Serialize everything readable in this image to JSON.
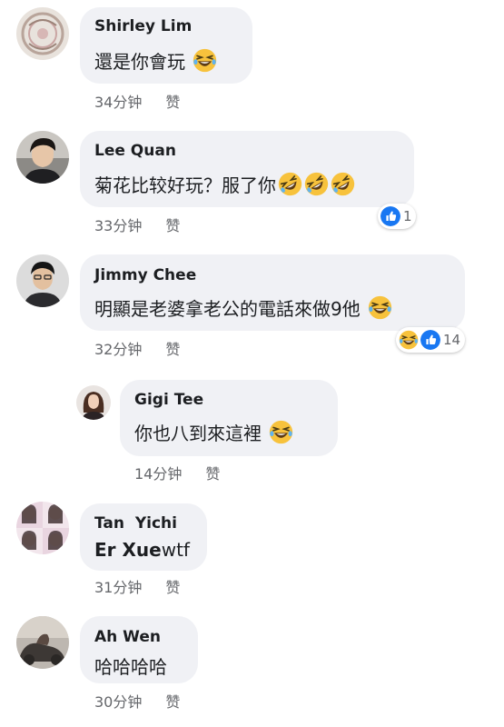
{
  "comments": [
    {
      "name": "Shirley Lim",
      "text": "還是你會玩",
      "time": "34分钟",
      "like": "赞"
    },
    {
      "name": "Lee Quan",
      "text": "菊花比较好玩？服了你",
      "time": "33分钟",
      "like": "赞",
      "reaction_count": "1"
    },
    {
      "name": "Jimmy Chee",
      "text": "明顯是老婆拿老公的電話來做9他",
      "time": "32分钟",
      "like": "赞",
      "reaction_count": "14"
    },
    {
      "name": "Gigi Tee",
      "text": "你也八到來這裡",
      "time": "14分钟",
      "like": "赞"
    },
    {
      "name": "Tan  Yichi",
      "text_bold": "Er Xue",
      "text_rest": "wtf",
      "time": "31分钟",
      "like": "赞"
    },
    {
      "name": "Ah Wen",
      "text": "哈哈哈哈",
      "time": "30分钟",
      "like": "赞"
    }
  ],
  "colors": {
    "bubble": "#f0f1f5",
    "meta_text": "#65676b",
    "like_blue": "#1877f2",
    "emoji_yellow": "#f7c23c"
  }
}
